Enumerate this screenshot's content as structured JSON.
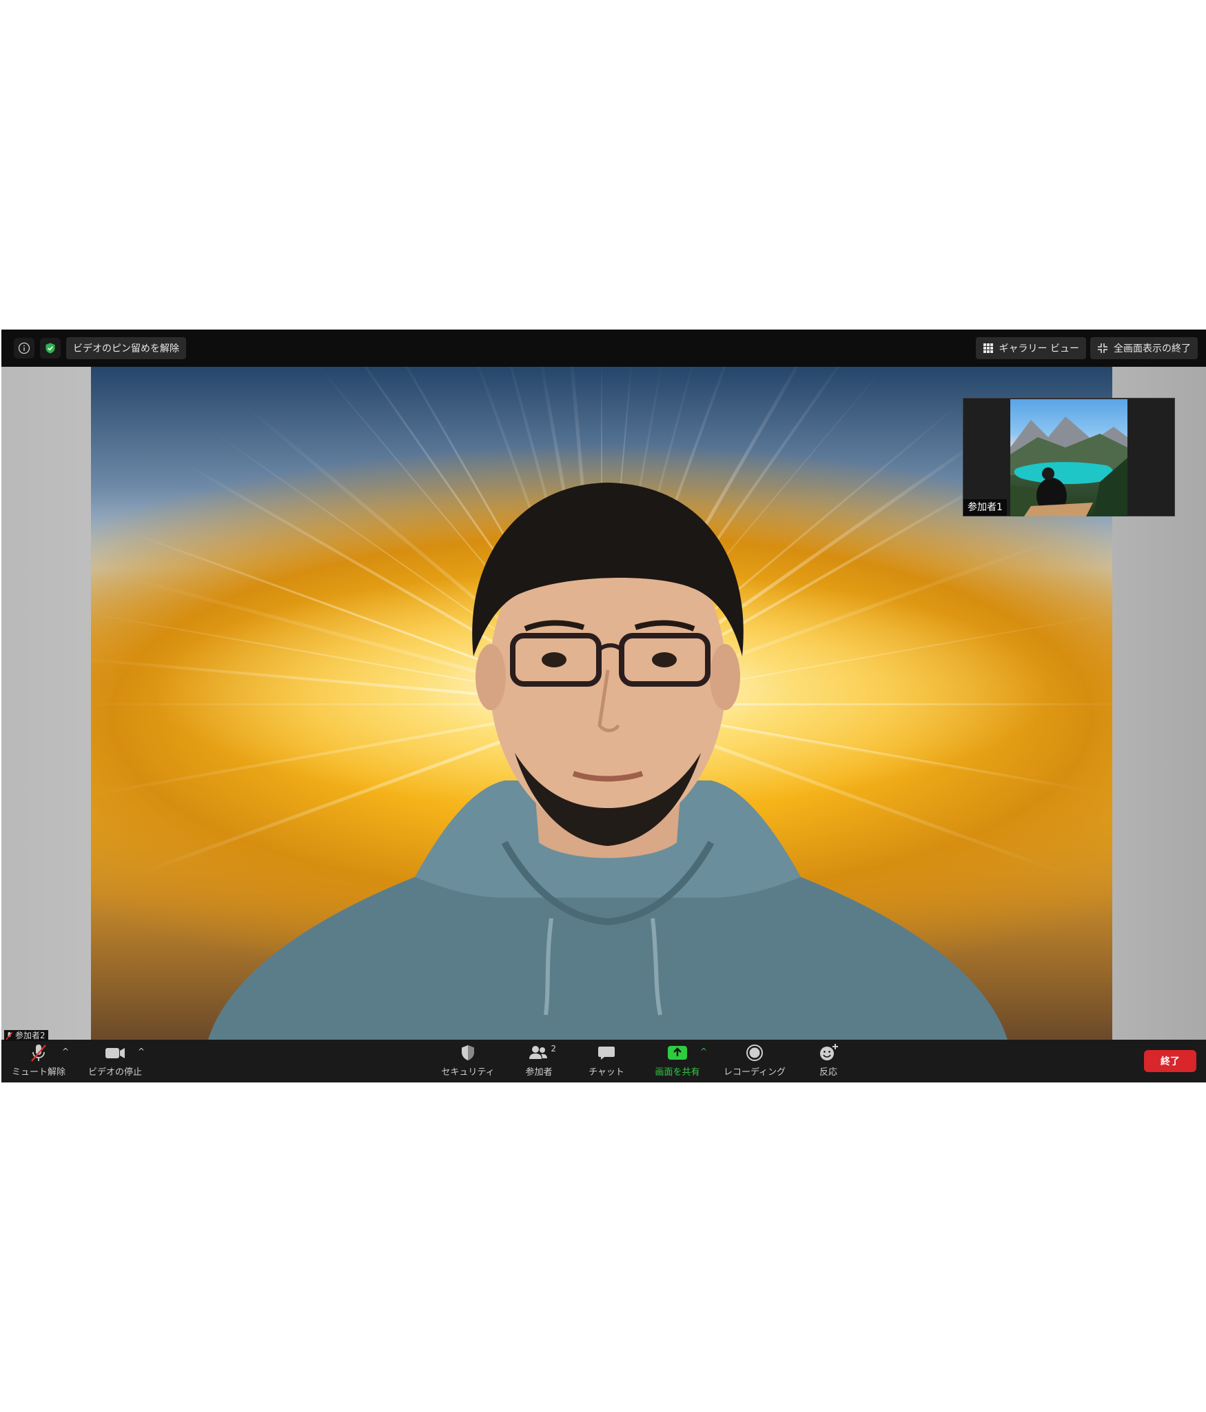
{
  "top_bar": {
    "unpin_video_label": "ビデオのピン留めを解除",
    "gallery_view_label": "ギャラリー ビュー",
    "exit_fullscreen_label": "全画面表示の終了"
  },
  "thumbnail": {
    "participant_name": "参加者1"
  },
  "main_video": {
    "participant_name": "参加者2"
  },
  "toolbar": {
    "unmute_label": "ミュート解除",
    "stop_video_label": "ビデオの停止",
    "security_label": "セキュリティ",
    "participants_label": "参加者",
    "participants_count": "2",
    "chat_label": "チャット",
    "share_screen_label": "画面を共有",
    "recording_label": "レコーディング",
    "reactions_label": "反応",
    "end_label": "終了"
  },
  "colors": {
    "security_shield": "#2fb350",
    "share_screen": "#2ecc40",
    "end_button": "#d8262b",
    "muted_slash": "#e03030"
  }
}
